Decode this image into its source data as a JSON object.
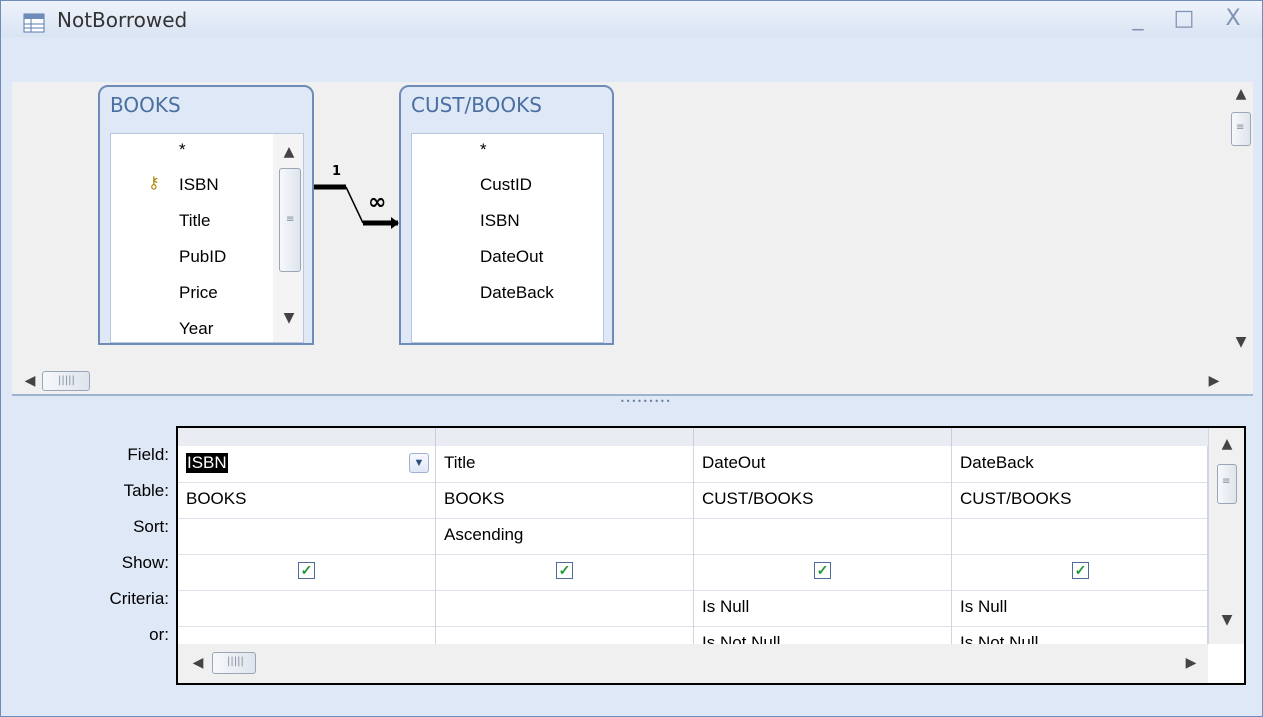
{
  "window": {
    "title": "NotBorrowed",
    "controls": {
      "minimize": "_",
      "maximize": "□",
      "close": "X"
    }
  },
  "tables": [
    {
      "name": "BOOKS",
      "fields": [
        "*",
        "ISBN",
        "Title",
        "PubID",
        "Price",
        "Year"
      ],
      "primary_key": "ISBN"
    },
    {
      "name": "CUST/BOOKS",
      "fields": [
        "*",
        "CustID",
        "ISBN",
        "DateOut",
        "DateBack"
      ]
    }
  ],
  "relationship": {
    "one_label": "1",
    "many_label": "∞"
  },
  "qbe": {
    "row_labels": [
      "Field:",
      "Table:",
      "Sort:",
      "Show:",
      "Criteria:",
      "or:"
    ],
    "columns": [
      {
        "field": "ISBN",
        "table": "BOOKS",
        "sort": "",
        "show": true,
        "criteria": "",
        "or": "",
        "selected": true
      },
      {
        "field": "Title",
        "table": "BOOKS",
        "sort": "Ascending",
        "show": true,
        "criteria": "",
        "or": ""
      },
      {
        "field": "DateOut",
        "table": "CUST/BOOKS",
        "sort": "",
        "show": true,
        "criteria": "Is Null",
        "or": "Is Not Null"
      },
      {
        "field": "DateBack",
        "table": "CUST/BOOKS",
        "sort": "",
        "show": true,
        "criteria": "Is Null",
        "or": "Is Not Null"
      }
    ]
  },
  "icons": {
    "app": "query-design-icon",
    "key": "primary-key-icon",
    "check": "checkmark-icon"
  },
  "colors": {
    "frame": "#6f8bb8",
    "panel": "#dfe8f6",
    "title_text": "#4a6fa0",
    "check": "#1e9b2d"
  }
}
